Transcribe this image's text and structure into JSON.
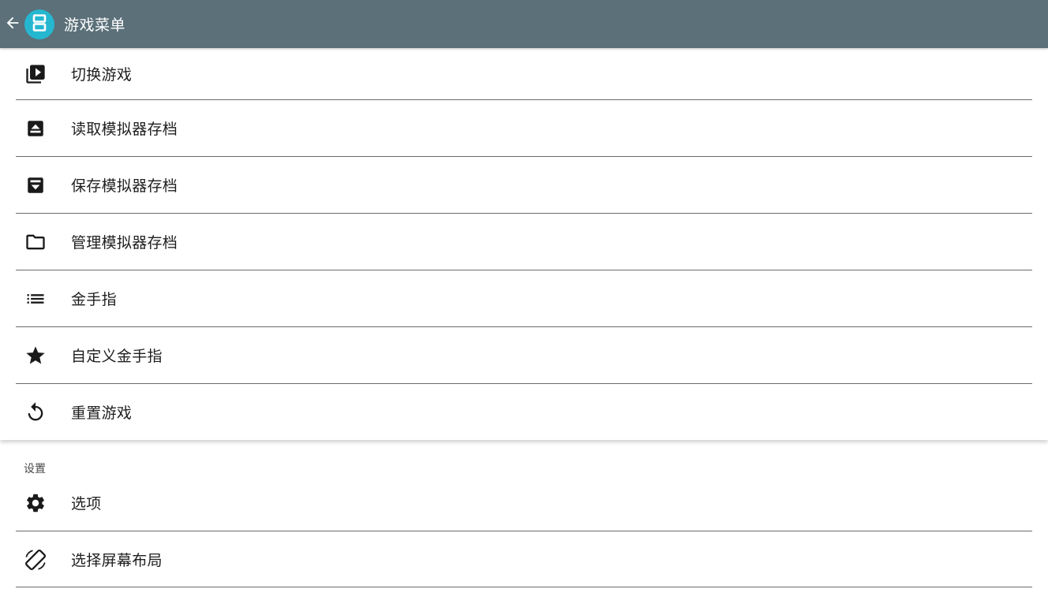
{
  "appbar": {
    "title": "游戏菜单",
    "back_icon": "arrow-left-icon",
    "logo_icon": "dual-screen-logo-icon",
    "background": "#5b7079",
    "logo_color": "#26b7d0"
  },
  "menu": {
    "items": [
      {
        "label": "切换游戏",
        "icon": "switch-game-icon"
      },
      {
        "label": "读取模拟器存档",
        "icon": "load-state-icon"
      },
      {
        "label": "保存模拟器存档",
        "icon": "save-state-icon"
      },
      {
        "label": "管理模拟器存档",
        "icon": "folder-icon"
      },
      {
        "label": "金手指",
        "icon": "list-icon"
      },
      {
        "label": "自定义金手指",
        "icon": "star-icon"
      },
      {
        "label": "重置游戏",
        "icon": "reset-icon"
      }
    ]
  },
  "settings": {
    "header": "设置",
    "items": [
      {
        "label": "选项",
        "icon": "gear-icon"
      },
      {
        "label": "选择屏幕布局",
        "icon": "screen-rotation-icon"
      }
    ]
  }
}
